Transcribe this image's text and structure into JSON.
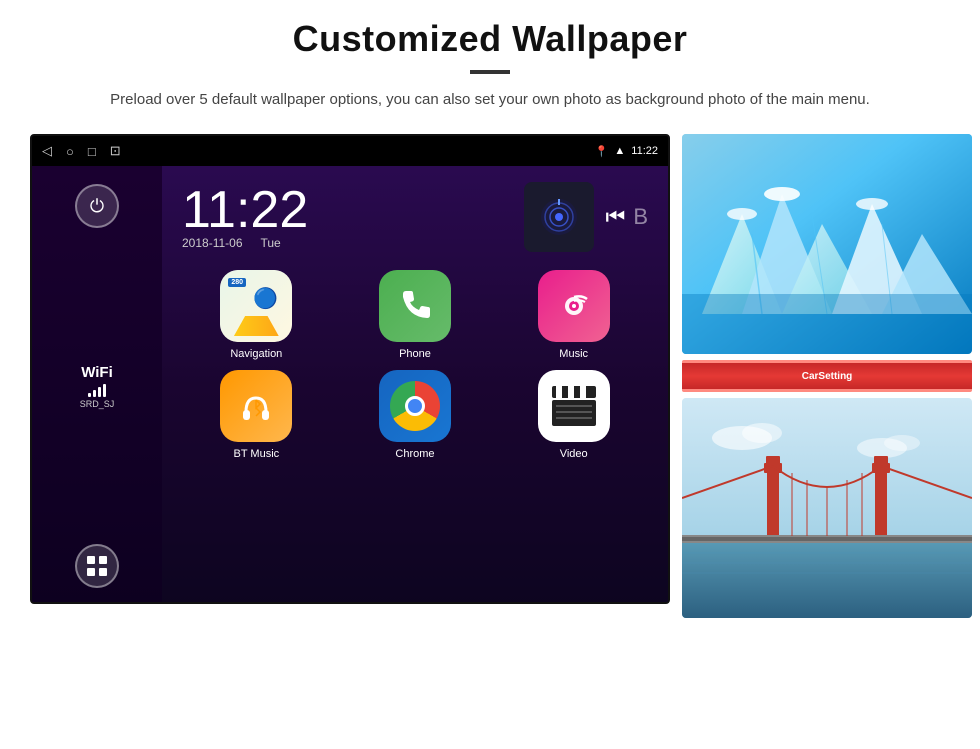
{
  "header": {
    "title": "Customized Wallpaper",
    "description": "Preload over 5 default wallpaper options, you can also set your own photo as background photo of the main menu."
  },
  "android": {
    "statusBar": {
      "time": "11:22",
      "navIcons": [
        "◁",
        "○",
        "□",
        "⊡"
      ]
    },
    "clock": {
      "time": "11:22",
      "date": "2018-11-06",
      "day": "Tue"
    },
    "wifi": {
      "label": "WiFi",
      "ssid": "SRD_SJ"
    },
    "apps": [
      {
        "name": "Navigation",
        "type": "navigation"
      },
      {
        "name": "Phone",
        "type": "phone"
      },
      {
        "name": "Music",
        "type": "music"
      },
      {
        "name": "BT Music",
        "type": "btmusic"
      },
      {
        "name": "Chrome",
        "type": "chrome"
      },
      {
        "name": "Video",
        "type": "video"
      }
    ]
  },
  "wallpapers": {
    "label1": "CarSetting"
  }
}
